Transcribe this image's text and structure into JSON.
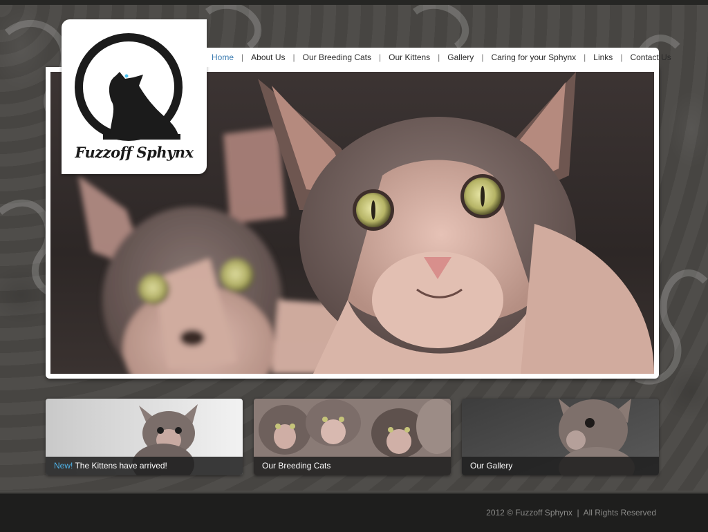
{
  "site": {
    "logo_text": "Fuzzoff Sphynx"
  },
  "nav": {
    "items": [
      {
        "label": "Home",
        "active": true
      },
      {
        "label": "About Us"
      },
      {
        "label": "Our Breeding Cats"
      },
      {
        "label": "Our Kittens"
      },
      {
        "label": "Gallery"
      },
      {
        "label": "Caring for your Sphynx"
      },
      {
        "label": "Links"
      },
      {
        "label": "Contact Us"
      }
    ],
    "separator": "|"
  },
  "cards": [
    {
      "badge": "New!",
      "label": "The Kittens have arrived!"
    },
    {
      "label": "Our Breeding Cats"
    },
    {
      "label": "Our Gallery"
    }
  ],
  "footer": {
    "text": "2012 © Fuzzoff Sphynx  |  All Rights Reserved"
  },
  "colors": {
    "nav_active": "#3b7bb0",
    "new_badge": "#4fb3e8",
    "footer_bg": "#1e1e1d",
    "page_bg": "#4b4a47"
  }
}
